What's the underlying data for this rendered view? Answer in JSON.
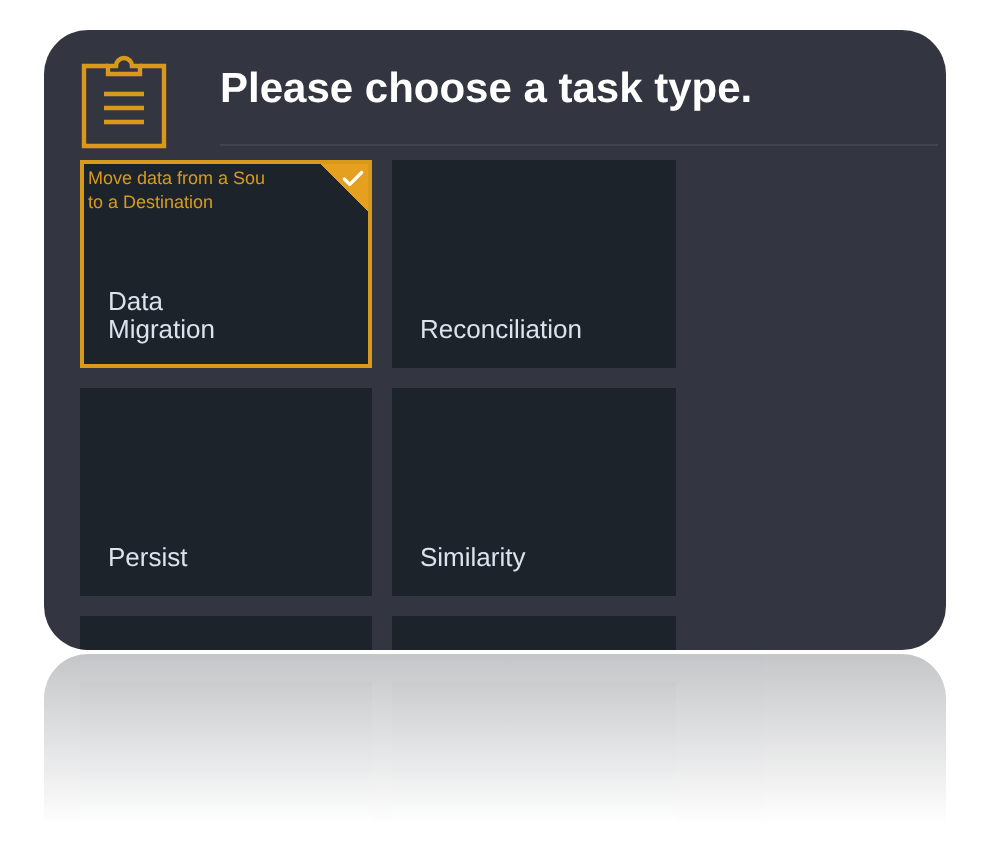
{
  "title": "Please choose a task type.",
  "tiles": [
    {
      "label": "Data\nMigration",
      "selected": true,
      "description": [
        "Move data from a Sou",
        "to a Destination"
      ]
    },
    {
      "label": "Reconciliation",
      "selected": false
    },
    {
      "label": "Persist",
      "selected": false
    },
    {
      "label": "Similarity",
      "selected": false
    },
    {
      "selected": false
    },
    {
      "selected": false
    }
  ]
}
